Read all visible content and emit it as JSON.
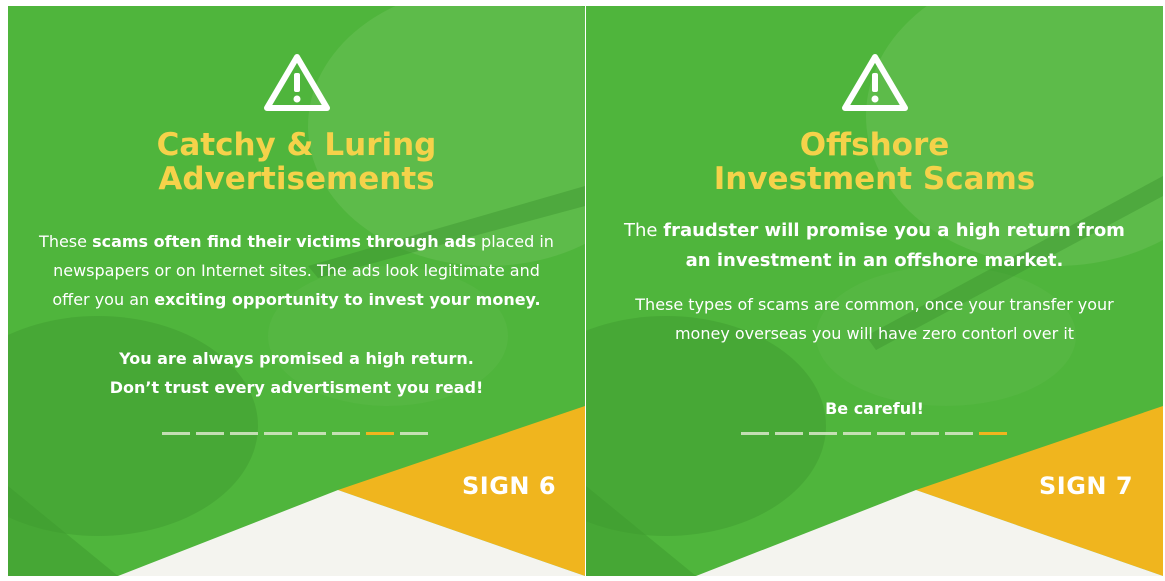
{
  "colors": {
    "green": "#4fb53c",
    "yellow": "#f0b51e",
    "title_yellow": "#f5d24a",
    "white": "#ffffff"
  },
  "cards": [
    {
      "icon": "warning-triangle-icon",
      "title_lines": [
        "Catchy & Luring",
        "Advertisements"
      ],
      "paragraph1": [
        {
          "text": "These ",
          "bold": false
        },
        {
          "text": "scams often find their victims through ads",
          "bold": true
        },
        {
          "text": " placed in newspapers or on Internet sites. The ads look legitimate and offer you an ",
          "bold": false
        },
        {
          "text": "exciting opportunity to invest your money.",
          "bold": true
        }
      ],
      "paragraph2_lines": [
        "You are always promised a high return.",
        "Don’t trust every advertisment you read!"
      ],
      "progress": {
        "total": 8,
        "active": 7
      },
      "sign": "SIGN 6"
    },
    {
      "icon": "warning-triangle-icon",
      "title_lines": [
        "Offshore",
        "Investment Scams"
      ],
      "paragraph1": [
        {
          "text": "The ",
          "bold": false
        },
        {
          "text": "fraudster will promise you a high return from an investment in an offshore market.",
          "bold": true
        }
      ],
      "paragraph2": "These types of scams are common, once your transfer your money overseas you will have zero contorl over it",
      "paragraph3": "Be careful!",
      "progress": {
        "total": 8,
        "active": 8
      },
      "sign": "SIGN 7"
    }
  ]
}
